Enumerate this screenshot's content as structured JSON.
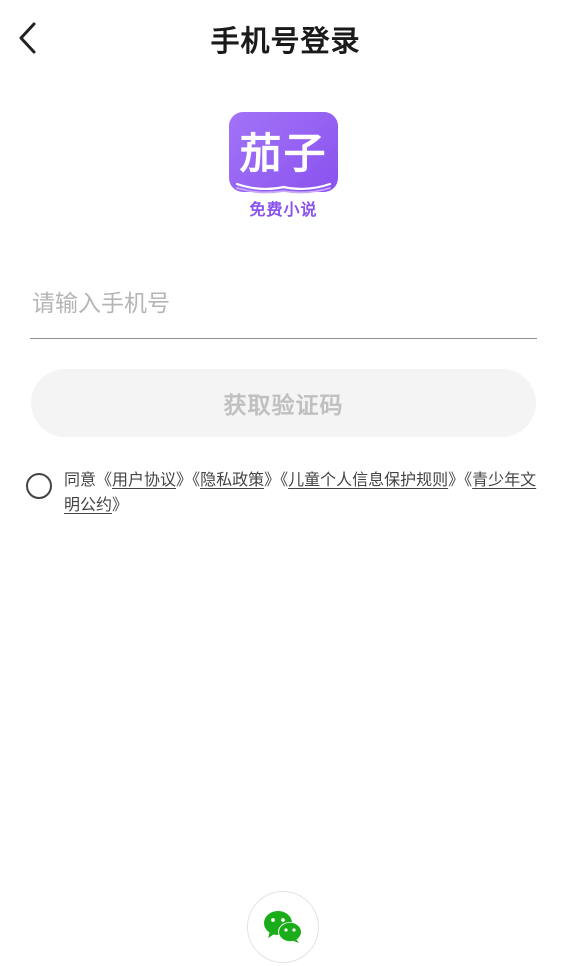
{
  "header": {
    "title": "手机号登录",
    "back_icon": "chevron-left-icon"
  },
  "logo": {
    "name": "茄子",
    "subtitle": "免费小说",
    "brand_color": "#8a52ee"
  },
  "form": {
    "phone_placeholder": "请输入手机号",
    "phone_value": "",
    "get_code_label": "获取验证码"
  },
  "agreement": {
    "checked": false,
    "prefix": "同意",
    "links": [
      {
        "open": "《",
        "text": "用户协议",
        "close": "》"
      },
      {
        "open": "《",
        "text": "隐私政策",
        "close": "》"
      },
      {
        "open": "《",
        "text": "儿童个人信息保护规则",
        "close": "》"
      },
      {
        "open": "《",
        "text": "青少年文明公约",
        "close": "》"
      }
    ]
  },
  "social_login": {
    "icon": "wechat-icon",
    "color": "#1aad19"
  }
}
